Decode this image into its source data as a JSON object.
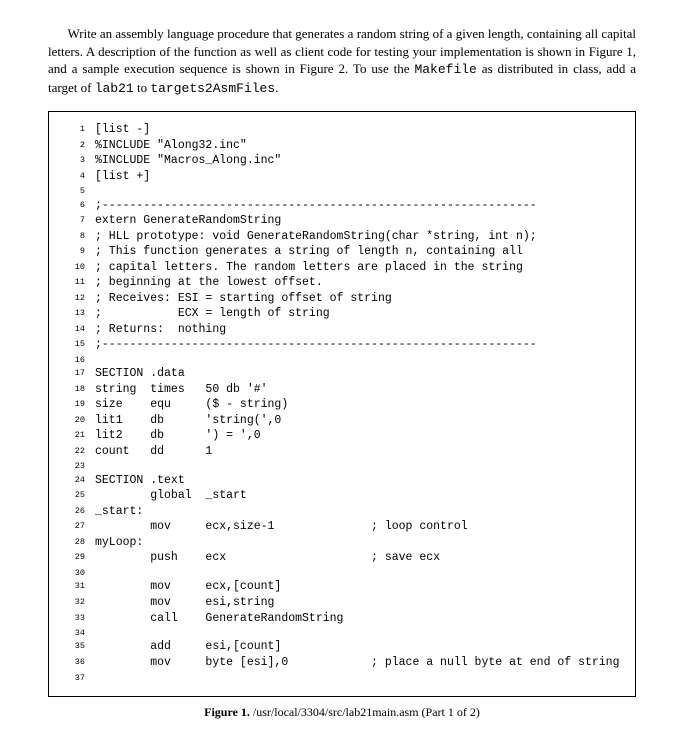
{
  "intro": {
    "part1": "Write an assembly language procedure that generates a random string of a given length, containing all capital letters. A description of the function as well as client code for testing your implementation is shown in Figure 1, and a sample execution sequence is shown in Figure 2. To use the ",
    "code1": "Makefile",
    "part2": " as distributed in class, add a target of ",
    "code2": "lab21",
    "part3": " to ",
    "code3": "targets2AsmFiles",
    "part4": "."
  },
  "code_lines": [
    "[list -]",
    "%INCLUDE \"Along32.inc\"",
    "%INCLUDE \"Macros_Along.inc\"",
    "[list +]",
    "",
    ";---------------------------------------------------------------",
    "extern GenerateRandomString",
    "; HLL prototype: void GenerateRandomString(char *string, int n);",
    "; This function generates a string of length n, containing all",
    "; capital letters. The random letters are placed in the string",
    "; beginning at the lowest offset.",
    "; Receives: ESI = starting offset of string",
    ";           ECX = length of string",
    "; Returns:  nothing",
    ";---------------------------------------------------------------",
    "",
    "SECTION .data",
    "string  times   50 db '#'",
    "size    equ     ($ - string)",
    "lit1    db      'string(',0",
    "lit2    db      ') = ',0",
    "count   dd      1",
    "",
    "SECTION .text",
    "        global  _start",
    "_start:",
    "        mov     ecx,size-1              ; loop control",
    "myLoop:",
    "        push    ecx                     ; save ecx",
    "",
    "        mov     ecx,[count]",
    "        mov     esi,string",
    "        call    GenerateRandomString",
    "",
    "        add     esi,[count]",
    "        mov     byte [esi],0            ; place a null byte at end of string",
    ""
  ],
  "caption": {
    "label": "Figure 1.",
    "text": " /usr/local/3304/src/lab21main.asm (Part 1 of 2)"
  }
}
